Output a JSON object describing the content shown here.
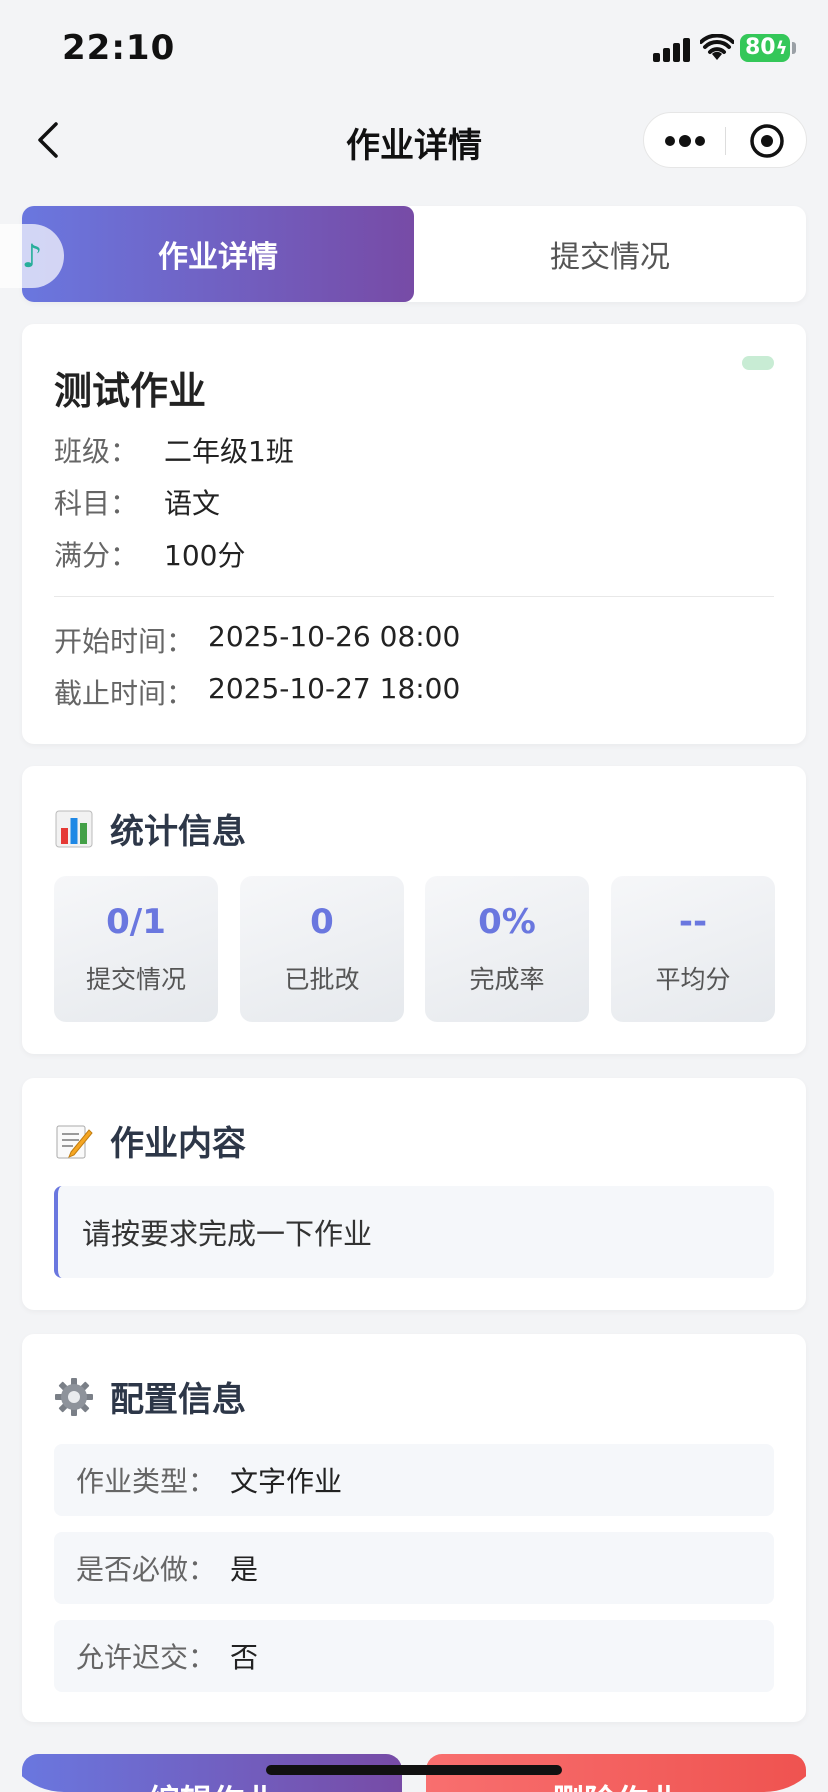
{
  "status_bar": {
    "time": "22:10",
    "battery": "80"
  },
  "nav": {
    "title": "作业详情"
  },
  "tabs": [
    {
      "label": "作业详情",
      "active": true
    },
    {
      "label": "提交情况",
      "active": false
    }
  ],
  "homework": {
    "title": "测试作业",
    "rows": [
      {
        "label": "班级：",
        "value": "二年级1班"
      },
      {
        "label": "科目：",
        "value": "语文"
      },
      {
        "label": "满分：",
        "value": "100分"
      }
    ],
    "time_rows": [
      {
        "label": "开始时间：",
        "value": "2025-10-26 08:00"
      },
      {
        "label": "截止时间：",
        "value": "2025-10-27 18:00"
      }
    ]
  },
  "stats": {
    "title": "统计信息",
    "items": [
      {
        "value": "0/1",
        "label": "提交情况"
      },
      {
        "value": "0",
        "label": "已批改"
      },
      {
        "value": "0%",
        "label": "完成率"
      },
      {
        "value": "--",
        "label": "平均分"
      }
    ]
  },
  "content": {
    "title": "作业内容",
    "text": "请按要求完成一下作业"
  },
  "config": {
    "title": "配置信息",
    "rows": [
      {
        "label": "作业类型：",
        "value": "文字作业"
      },
      {
        "label": "是否必做：",
        "value": "是"
      },
      {
        "label": "允许迟交：",
        "value": "否"
      }
    ]
  },
  "actions": {
    "edit": "编辑作业",
    "delete": "删除作业"
  },
  "colors": {
    "accent_start": "#6a77df",
    "accent_end": "#774ba6",
    "danger": "#ef5350",
    "battery": "#34c759"
  }
}
